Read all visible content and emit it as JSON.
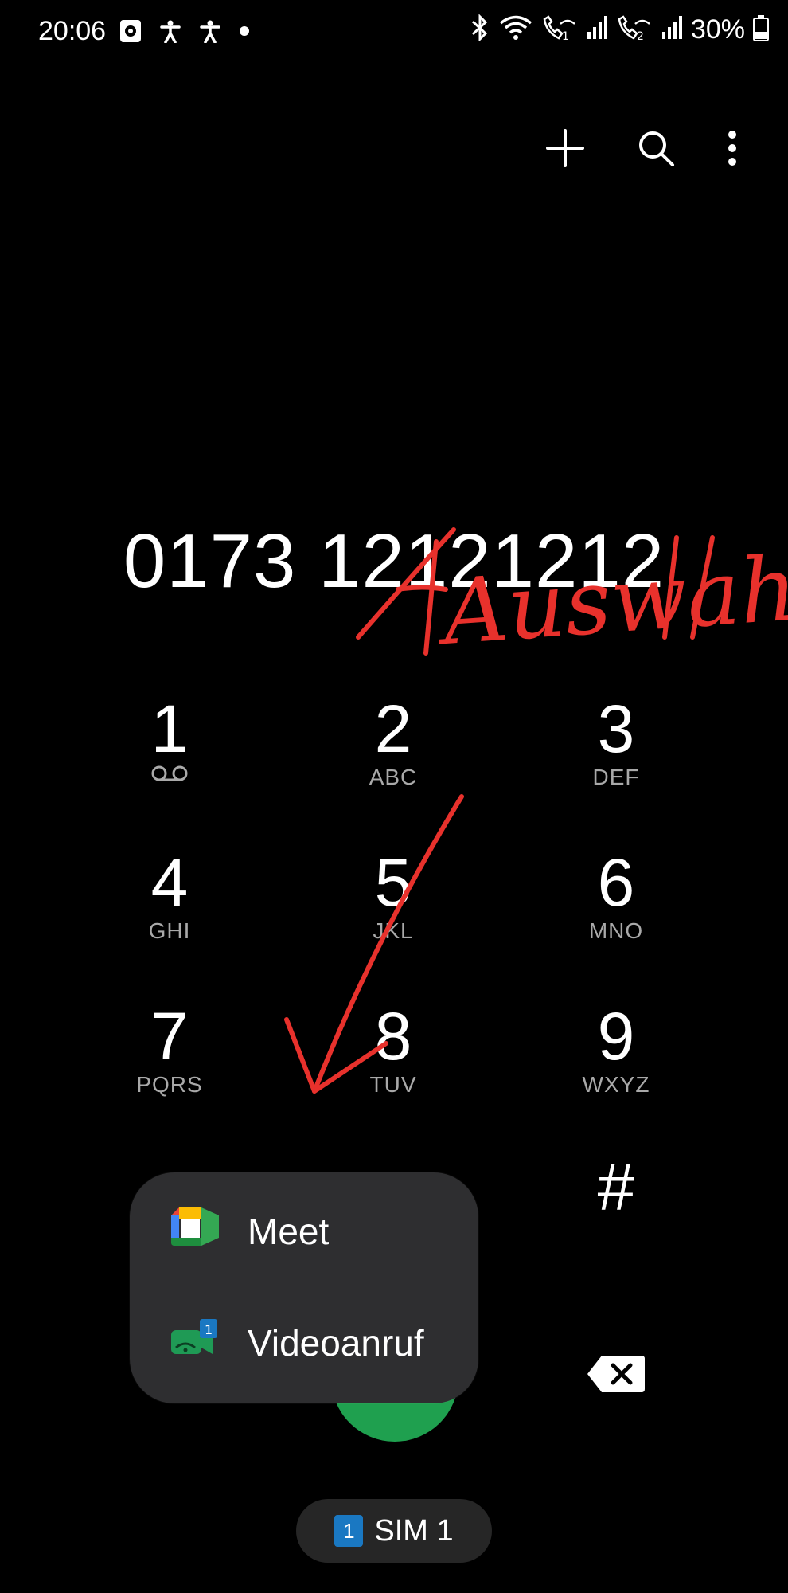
{
  "status_bar": {
    "time": "20:06",
    "battery": "30%",
    "icons": [
      "screen-recorder-icon",
      "accessibility-icon",
      "accessibility-icon",
      "dot-icon",
      "bluetooth-icon",
      "wifi-icon",
      "wifi-calling-sim1-icon",
      "signal-icon",
      "wifi-calling-sim2-icon",
      "signal-icon",
      "battery-icon"
    ]
  },
  "toolbar": {
    "icons": [
      "add-icon",
      "search-icon",
      "more-options-icon"
    ]
  },
  "dialer": {
    "number": "0173 12121212",
    "keys": [
      {
        "digit": "1",
        "letters": ""
      },
      {
        "digit": "2",
        "letters": "ABC"
      },
      {
        "digit": "3",
        "letters": "DEF"
      },
      {
        "digit": "4",
        "letters": "GHI"
      },
      {
        "digit": "5",
        "letters": "JKL"
      },
      {
        "digit": "6",
        "letters": "MNO"
      },
      {
        "digit": "7",
        "letters": "PQRS"
      },
      {
        "digit": "8",
        "letters": "TUV"
      },
      {
        "digit": "9",
        "letters": "WXYZ"
      },
      {
        "digit": "#",
        "letters": ""
      }
    ]
  },
  "popup": {
    "items": [
      {
        "label": "Meet",
        "icon": "google-meet-icon"
      },
      {
        "label": "Videoanruf",
        "icon": "video-call-icon",
        "badge": "1"
      }
    ]
  },
  "sim": {
    "label": "SIM 1",
    "badge": "1"
  },
  "annotation": {
    "text": "Auswahl",
    "color": "#e8312c"
  }
}
